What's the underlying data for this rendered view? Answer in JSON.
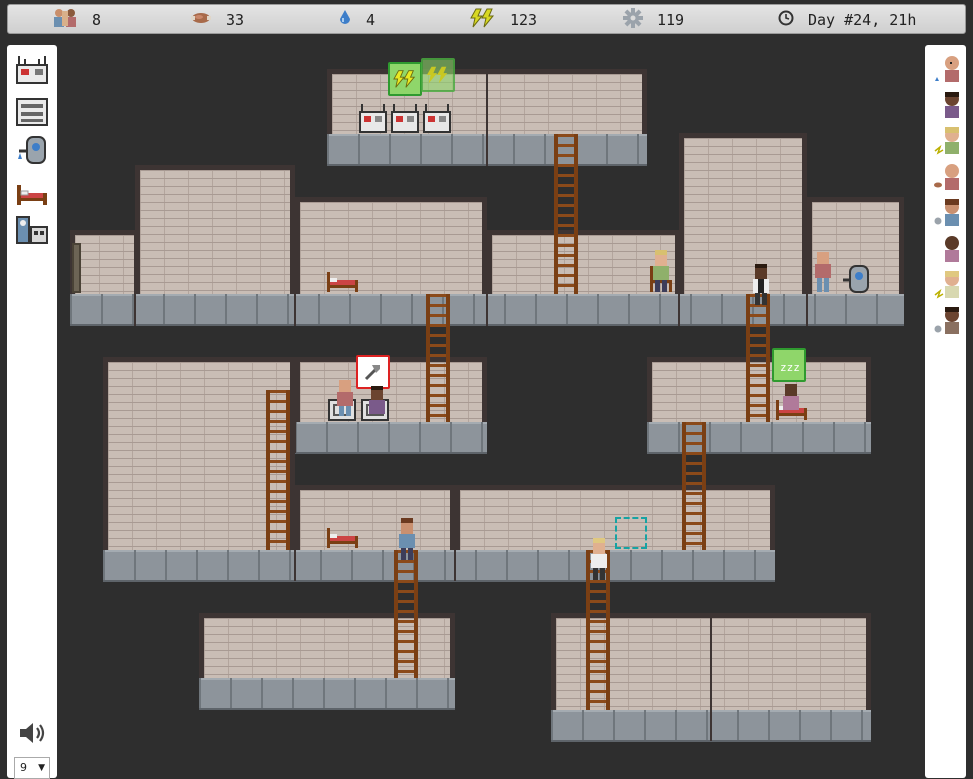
{
  "resources": {
    "population": {
      "icon": "people-icon",
      "value": "8"
    },
    "food": {
      "icon": "food-icon",
      "value": "33"
    },
    "water": {
      "icon": "water-drop-icon",
      "value": "4"
    },
    "energy": {
      "icon": "lightning-icon",
      "value": "123"
    },
    "parts": {
      "icon": "gear-icon",
      "value": "119"
    },
    "time": {
      "icon": "clock-icon",
      "value": "Day #24, 21h"
    }
  },
  "toolbar": {
    "items": [
      "generator-icon",
      "storage-icon",
      "water-pump-icon",
      "bed-icon",
      "workshop-icon"
    ]
  },
  "speed_select": {
    "value": "9"
  },
  "colonists": [
    "water",
    "none",
    "energy",
    "food",
    "parts",
    "none",
    "energy",
    "parts"
  ],
  "colors": {
    "background": "#2e2e2e",
    "brick": "#c9bdb5",
    "floor": "#8d949b",
    "ladder": "#7a3f14",
    "selection": "#16a3a3"
  }
}
